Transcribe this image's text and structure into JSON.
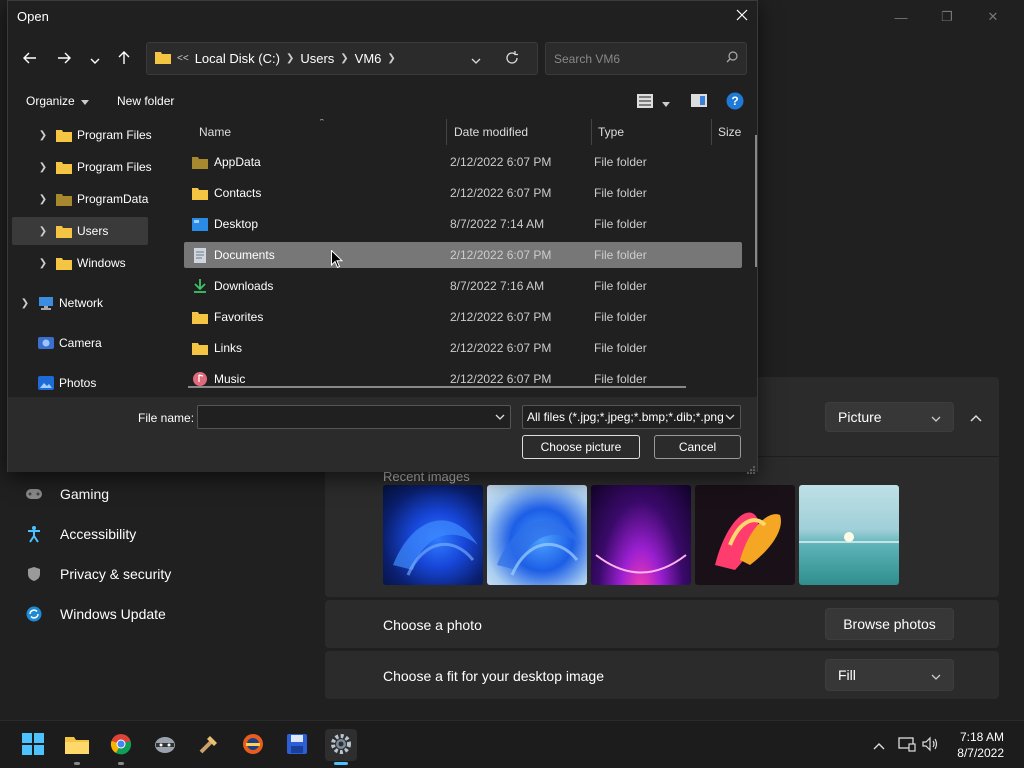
{
  "settings": {
    "nav": [
      {
        "label": "Gaming",
        "icon": "gamepad-icon"
      },
      {
        "label": "Accessibility",
        "icon": "accessibility-icon"
      },
      {
        "label": "Privacy & security",
        "icon": "shield-icon"
      },
      {
        "label": "Windows Update",
        "icon": "refresh-icon"
      }
    ],
    "background_type": "Picture",
    "recent_images_label": "Recent images",
    "choose_photo_label": "Choose a photo",
    "browse_photos_label": "Browse photos",
    "fit_label": "Choose a fit for your desktop image",
    "fit_value": "Fill"
  },
  "dialog": {
    "title": "Open",
    "breadcrumbs": [
      "Local Disk (C:)",
      "Users",
      "VM6"
    ],
    "search_placeholder": "Search VM6",
    "organize_label": "Organize",
    "new_folder_label": "New folder",
    "tree": [
      {
        "label": "Program Files",
        "icon": "folder-icon",
        "selected": false
      },
      {
        "label": "Program Files",
        "icon": "folder-icon",
        "selected": false
      },
      {
        "label": "ProgramData",
        "icon": "folder-icon",
        "selected": false
      },
      {
        "label": "Users",
        "icon": "folder-icon",
        "selected": true
      },
      {
        "label": "Windows",
        "icon": "folder-icon",
        "selected": false
      },
      {
        "label": "Network",
        "icon": "network-icon",
        "selected": false
      },
      {
        "label": "Camera",
        "icon": "camera-icon",
        "selected": false
      },
      {
        "label": "Photos",
        "icon": "photos-icon",
        "selected": false
      }
    ],
    "columns": [
      "Name",
      "Date modified",
      "Type",
      "Size"
    ],
    "files": [
      {
        "name": "AppData",
        "date": "2/12/2022 6:07 PM",
        "type": "File folder",
        "icon": "folder-icon"
      },
      {
        "name": "Contacts",
        "date": "2/12/2022 6:07 PM",
        "type": "File folder",
        "icon": "folder-icon"
      },
      {
        "name": "Desktop",
        "date": "8/7/2022 7:14 AM",
        "type": "File folder",
        "icon": "desktop-icon"
      },
      {
        "name": "Documents",
        "date": "2/12/2022 6:07 PM",
        "type": "File folder",
        "icon": "documents-icon"
      },
      {
        "name": "Downloads",
        "date": "8/7/2022 7:16 AM",
        "type": "File folder",
        "icon": "download-icon"
      },
      {
        "name": "Favorites",
        "date": "2/12/2022 6:07 PM",
        "type": "File folder",
        "icon": "folder-icon"
      },
      {
        "name": "Links",
        "date": "2/12/2022 6:07 PM",
        "type": "File folder",
        "icon": "folder-icon"
      },
      {
        "name": "Music",
        "date": "2/12/2022 6:07 PM",
        "type": "File folder",
        "icon": "music-icon"
      }
    ],
    "file_name_label": "File name:",
    "file_name_value": "",
    "file_type_value": "All files (*.jpg;*.jpeg;*.bmp;*.dib;*.png",
    "choose_button": "Choose picture",
    "cancel_button": "Cancel"
  },
  "taskbar": {
    "time": "7:18 AM",
    "date": "8/7/2022"
  }
}
